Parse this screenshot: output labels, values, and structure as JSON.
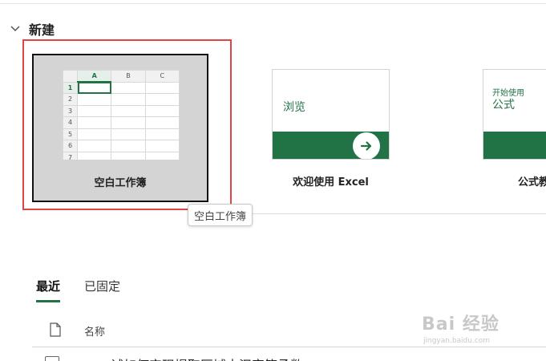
{
  "section": {
    "title": "新建"
  },
  "templates": {
    "blank": {
      "label": "空白工作簿",
      "columns": [
        "A",
        "B",
        "C"
      ],
      "rows": [
        "1",
        "2",
        "3",
        "4",
        "5",
        "6",
        "7"
      ]
    },
    "welcome": {
      "tile_text": "浏览",
      "label": "欢迎使用 Excel"
    },
    "formula": {
      "tile_small": "开始使用",
      "tile_big": "公式",
      "label": "公式教"
    }
  },
  "tooltip": "空白工作簿",
  "tabs": [
    {
      "label": "最近",
      "active": true
    },
    {
      "label": "已固定",
      "active": false
    }
  ],
  "list": {
    "name_header": "名称",
    "partial_row_text": "试如何实现提取区域中汉字等函数"
  },
  "watermark": {
    "brand": "Bai 经验",
    "sub": "jingyan.baidu.com"
  },
  "colors": {
    "accent": "#217346",
    "highlight_frame": "#e04545"
  },
  "icons": {
    "collapse": "chevron-down-icon",
    "arrow": "arrow-right-icon",
    "document": "document-icon"
  }
}
